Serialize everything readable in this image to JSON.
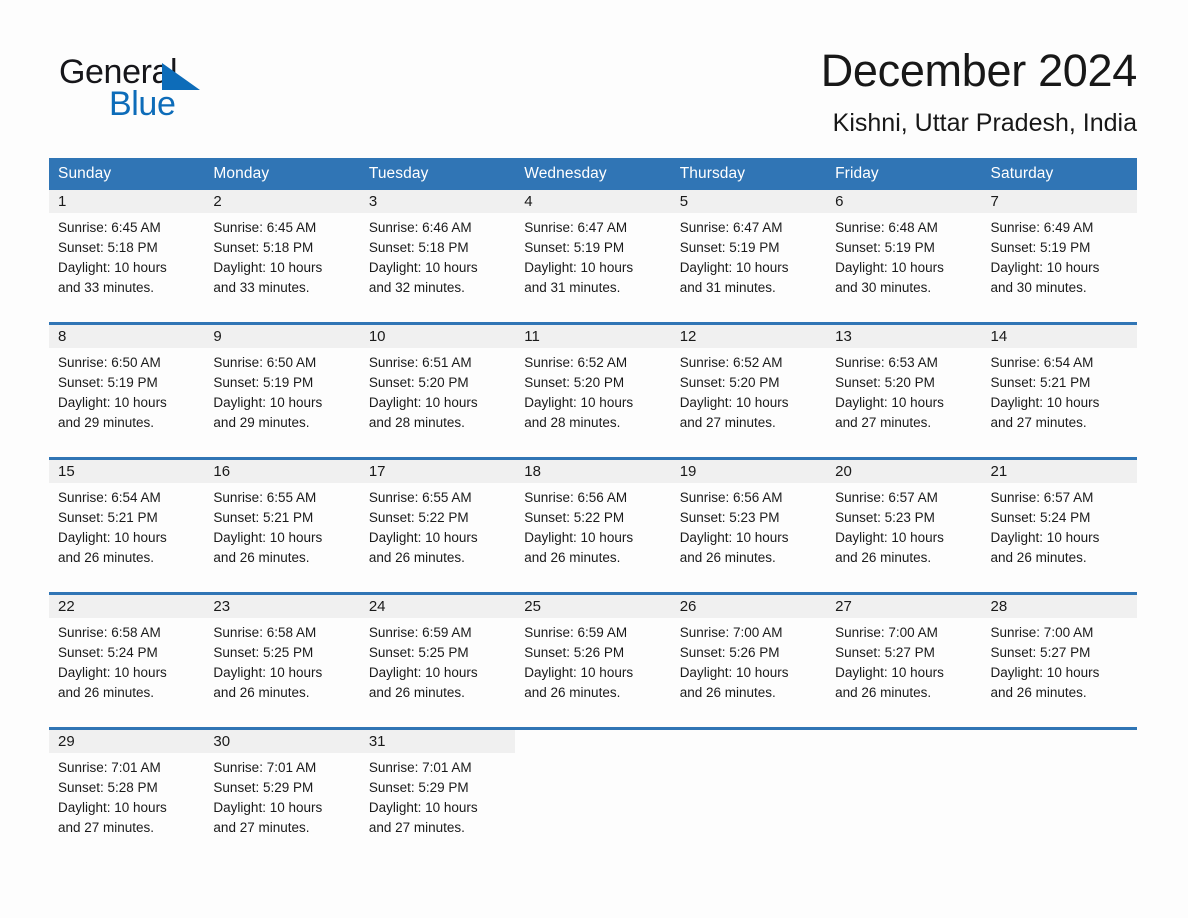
{
  "brand": {
    "name_top": "General",
    "name_bottom": "Blue",
    "triangle_color": "#0d6cb9"
  },
  "header": {
    "title": "December 2024",
    "subtitle": "Kishni, Uttar Pradesh, India"
  },
  "theme": {
    "header_blue": "#3075b5",
    "daynum_bg": "#f0f0f0",
    "page_bg": "#fdfdfd",
    "text": "#1a1a1a"
  },
  "weekdays": [
    "Sunday",
    "Monday",
    "Tuesday",
    "Wednesday",
    "Thursday",
    "Friday",
    "Saturday"
  ],
  "weeks": [
    [
      {
        "day": "1",
        "sunrise": "Sunrise: 6:45 AM",
        "sunset": "Sunset: 5:18 PM",
        "daylight1": "Daylight: 10 hours",
        "daylight2": "and 33 minutes."
      },
      {
        "day": "2",
        "sunrise": "Sunrise: 6:45 AM",
        "sunset": "Sunset: 5:18 PM",
        "daylight1": "Daylight: 10 hours",
        "daylight2": "and 33 minutes."
      },
      {
        "day": "3",
        "sunrise": "Sunrise: 6:46 AM",
        "sunset": "Sunset: 5:18 PM",
        "daylight1": "Daylight: 10 hours",
        "daylight2": "and 32 minutes."
      },
      {
        "day": "4",
        "sunrise": "Sunrise: 6:47 AM",
        "sunset": "Sunset: 5:19 PM",
        "daylight1": "Daylight: 10 hours",
        "daylight2": "and 31 minutes."
      },
      {
        "day": "5",
        "sunrise": "Sunrise: 6:47 AM",
        "sunset": "Sunset: 5:19 PM",
        "daylight1": "Daylight: 10 hours",
        "daylight2": "and 31 minutes."
      },
      {
        "day": "6",
        "sunrise": "Sunrise: 6:48 AM",
        "sunset": "Sunset: 5:19 PM",
        "daylight1": "Daylight: 10 hours",
        "daylight2": "and 30 minutes."
      },
      {
        "day": "7",
        "sunrise": "Sunrise: 6:49 AM",
        "sunset": "Sunset: 5:19 PM",
        "daylight1": "Daylight: 10 hours",
        "daylight2": "and 30 minutes."
      }
    ],
    [
      {
        "day": "8",
        "sunrise": "Sunrise: 6:50 AM",
        "sunset": "Sunset: 5:19 PM",
        "daylight1": "Daylight: 10 hours",
        "daylight2": "and 29 minutes."
      },
      {
        "day": "9",
        "sunrise": "Sunrise: 6:50 AM",
        "sunset": "Sunset: 5:19 PM",
        "daylight1": "Daylight: 10 hours",
        "daylight2": "and 29 minutes."
      },
      {
        "day": "10",
        "sunrise": "Sunrise: 6:51 AM",
        "sunset": "Sunset: 5:20 PM",
        "daylight1": "Daylight: 10 hours",
        "daylight2": "and 28 minutes."
      },
      {
        "day": "11",
        "sunrise": "Sunrise: 6:52 AM",
        "sunset": "Sunset: 5:20 PM",
        "daylight1": "Daylight: 10 hours",
        "daylight2": "and 28 minutes."
      },
      {
        "day": "12",
        "sunrise": "Sunrise: 6:52 AM",
        "sunset": "Sunset: 5:20 PM",
        "daylight1": "Daylight: 10 hours",
        "daylight2": "and 27 minutes."
      },
      {
        "day": "13",
        "sunrise": "Sunrise: 6:53 AM",
        "sunset": "Sunset: 5:20 PM",
        "daylight1": "Daylight: 10 hours",
        "daylight2": "and 27 minutes."
      },
      {
        "day": "14",
        "sunrise": "Sunrise: 6:54 AM",
        "sunset": "Sunset: 5:21 PM",
        "daylight1": "Daylight: 10 hours",
        "daylight2": "and 27 minutes."
      }
    ],
    [
      {
        "day": "15",
        "sunrise": "Sunrise: 6:54 AM",
        "sunset": "Sunset: 5:21 PM",
        "daylight1": "Daylight: 10 hours",
        "daylight2": "and 26 minutes."
      },
      {
        "day": "16",
        "sunrise": "Sunrise: 6:55 AM",
        "sunset": "Sunset: 5:21 PM",
        "daylight1": "Daylight: 10 hours",
        "daylight2": "and 26 minutes."
      },
      {
        "day": "17",
        "sunrise": "Sunrise: 6:55 AM",
        "sunset": "Sunset: 5:22 PM",
        "daylight1": "Daylight: 10 hours",
        "daylight2": "and 26 minutes."
      },
      {
        "day": "18",
        "sunrise": "Sunrise: 6:56 AM",
        "sunset": "Sunset: 5:22 PM",
        "daylight1": "Daylight: 10 hours",
        "daylight2": "and 26 minutes."
      },
      {
        "day": "19",
        "sunrise": "Sunrise: 6:56 AM",
        "sunset": "Sunset: 5:23 PM",
        "daylight1": "Daylight: 10 hours",
        "daylight2": "and 26 minutes."
      },
      {
        "day": "20",
        "sunrise": "Sunrise: 6:57 AM",
        "sunset": "Sunset: 5:23 PM",
        "daylight1": "Daylight: 10 hours",
        "daylight2": "and 26 minutes."
      },
      {
        "day": "21",
        "sunrise": "Sunrise: 6:57 AM",
        "sunset": "Sunset: 5:24 PM",
        "daylight1": "Daylight: 10 hours",
        "daylight2": "and 26 minutes."
      }
    ],
    [
      {
        "day": "22",
        "sunrise": "Sunrise: 6:58 AM",
        "sunset": "Sunset: 5:24 PM",
        "daylight1": "Daylight: 10 hours",
        "daylight2": "and 26 minutes."
      },
      {
        "day": "23",
        "sunrise": "Sunrise: 6:58 AM",
        "sunset": "Sunset: 5:25 PM",
        "daylight1": "Daylight: 10 hours",
        "daylight2": "and 26 minutes."
      },
      {
        "day": "24",
        "sunrise": "Sunrise: 6:59 AM",
        "sunset": "Sunset: 5:25 PM",
        "daylight1": "Daylight: 10 hours",
        "daylight2": "and 26 minutes."
      },
      {
        "day": "25",
        "sunrise": "Sunrise: 6:59 AM",
        "sunset": "Sunset: 5:26 PM",
        "daylight1": "Daylight: 10 hours",
        "daylight2": "and 26 minutes."
      },
      {
        "day": "26",
        "sunrise": "Sunrise: 7:00 AM",
        "sunset": "Sunset: 5:26 PM",
        "daylight1": "Daylight: 10 hours",
        "daylight2": "and 26 minutes."
      },
      {
        "day": "27",
        "sunrise": "Sunrise: 7:00 AM",
        "sunset": "Sunset: 5:27 PM",
        "daylight1": "Daylight: 10 hours",
        "daylight2": "and 26 minutes."
      },
      {
        "day": "28",
        "sunrise": "Sunrise: 7:00 AM",
        "sunset": "Sunset: 5:27 PM",
        "daylight1": "Daylight: 10 hours",
        "daylight2": "and 26 minutes."
      }
    ],
    [
      {
        "day": "29",
        "sunrise": "Sunrise: 7:01 AM",
        "sunset": "Sunset: 5:28 PM",
        "daylight1": "Daylight: 10 hours",
        "daylight2": "and 27 minutes."
      },
      {
        "day": "30",
        "sunrise": "Sunrise: 7:01 AM",
        "sunset": "Sunset: 5:29 PM",
        "daylight1": "Daylight: 10 hours",
        "daylight2": "and 27 minutes."
      },
      {
        "day": "31",
        "sunrise": "Sunrise: 7:01 AM",
        "sunset": "Sunset: 5:29 PM",
        "daylight1": "Daylight: 10 hours",
        "daylight2": "and 27 minutes."
      },
      {
        "day": "",
        "sunrise": "",
        "sunset": "",
        "daylight1": "",
        "daylight2": "",
        "empty": true
      },
      {
        "day": "",
        "sunrise": "",
        "sunset": "",
        "daylight1": "",
        "daylight2": "",
        "empty": true
      },
      {
        "day": "",
        "sunrise": "",
        "sunset": "",
        "daylight1": "",
        "daylight2": "",
        "empty": true
      },
      {
        "day": "",
        "sunrise": "",
        "sunset": "",
        "daylight1": "",
        "daylight2": "",
        "empty": true
      }
    ]
  ]
}
